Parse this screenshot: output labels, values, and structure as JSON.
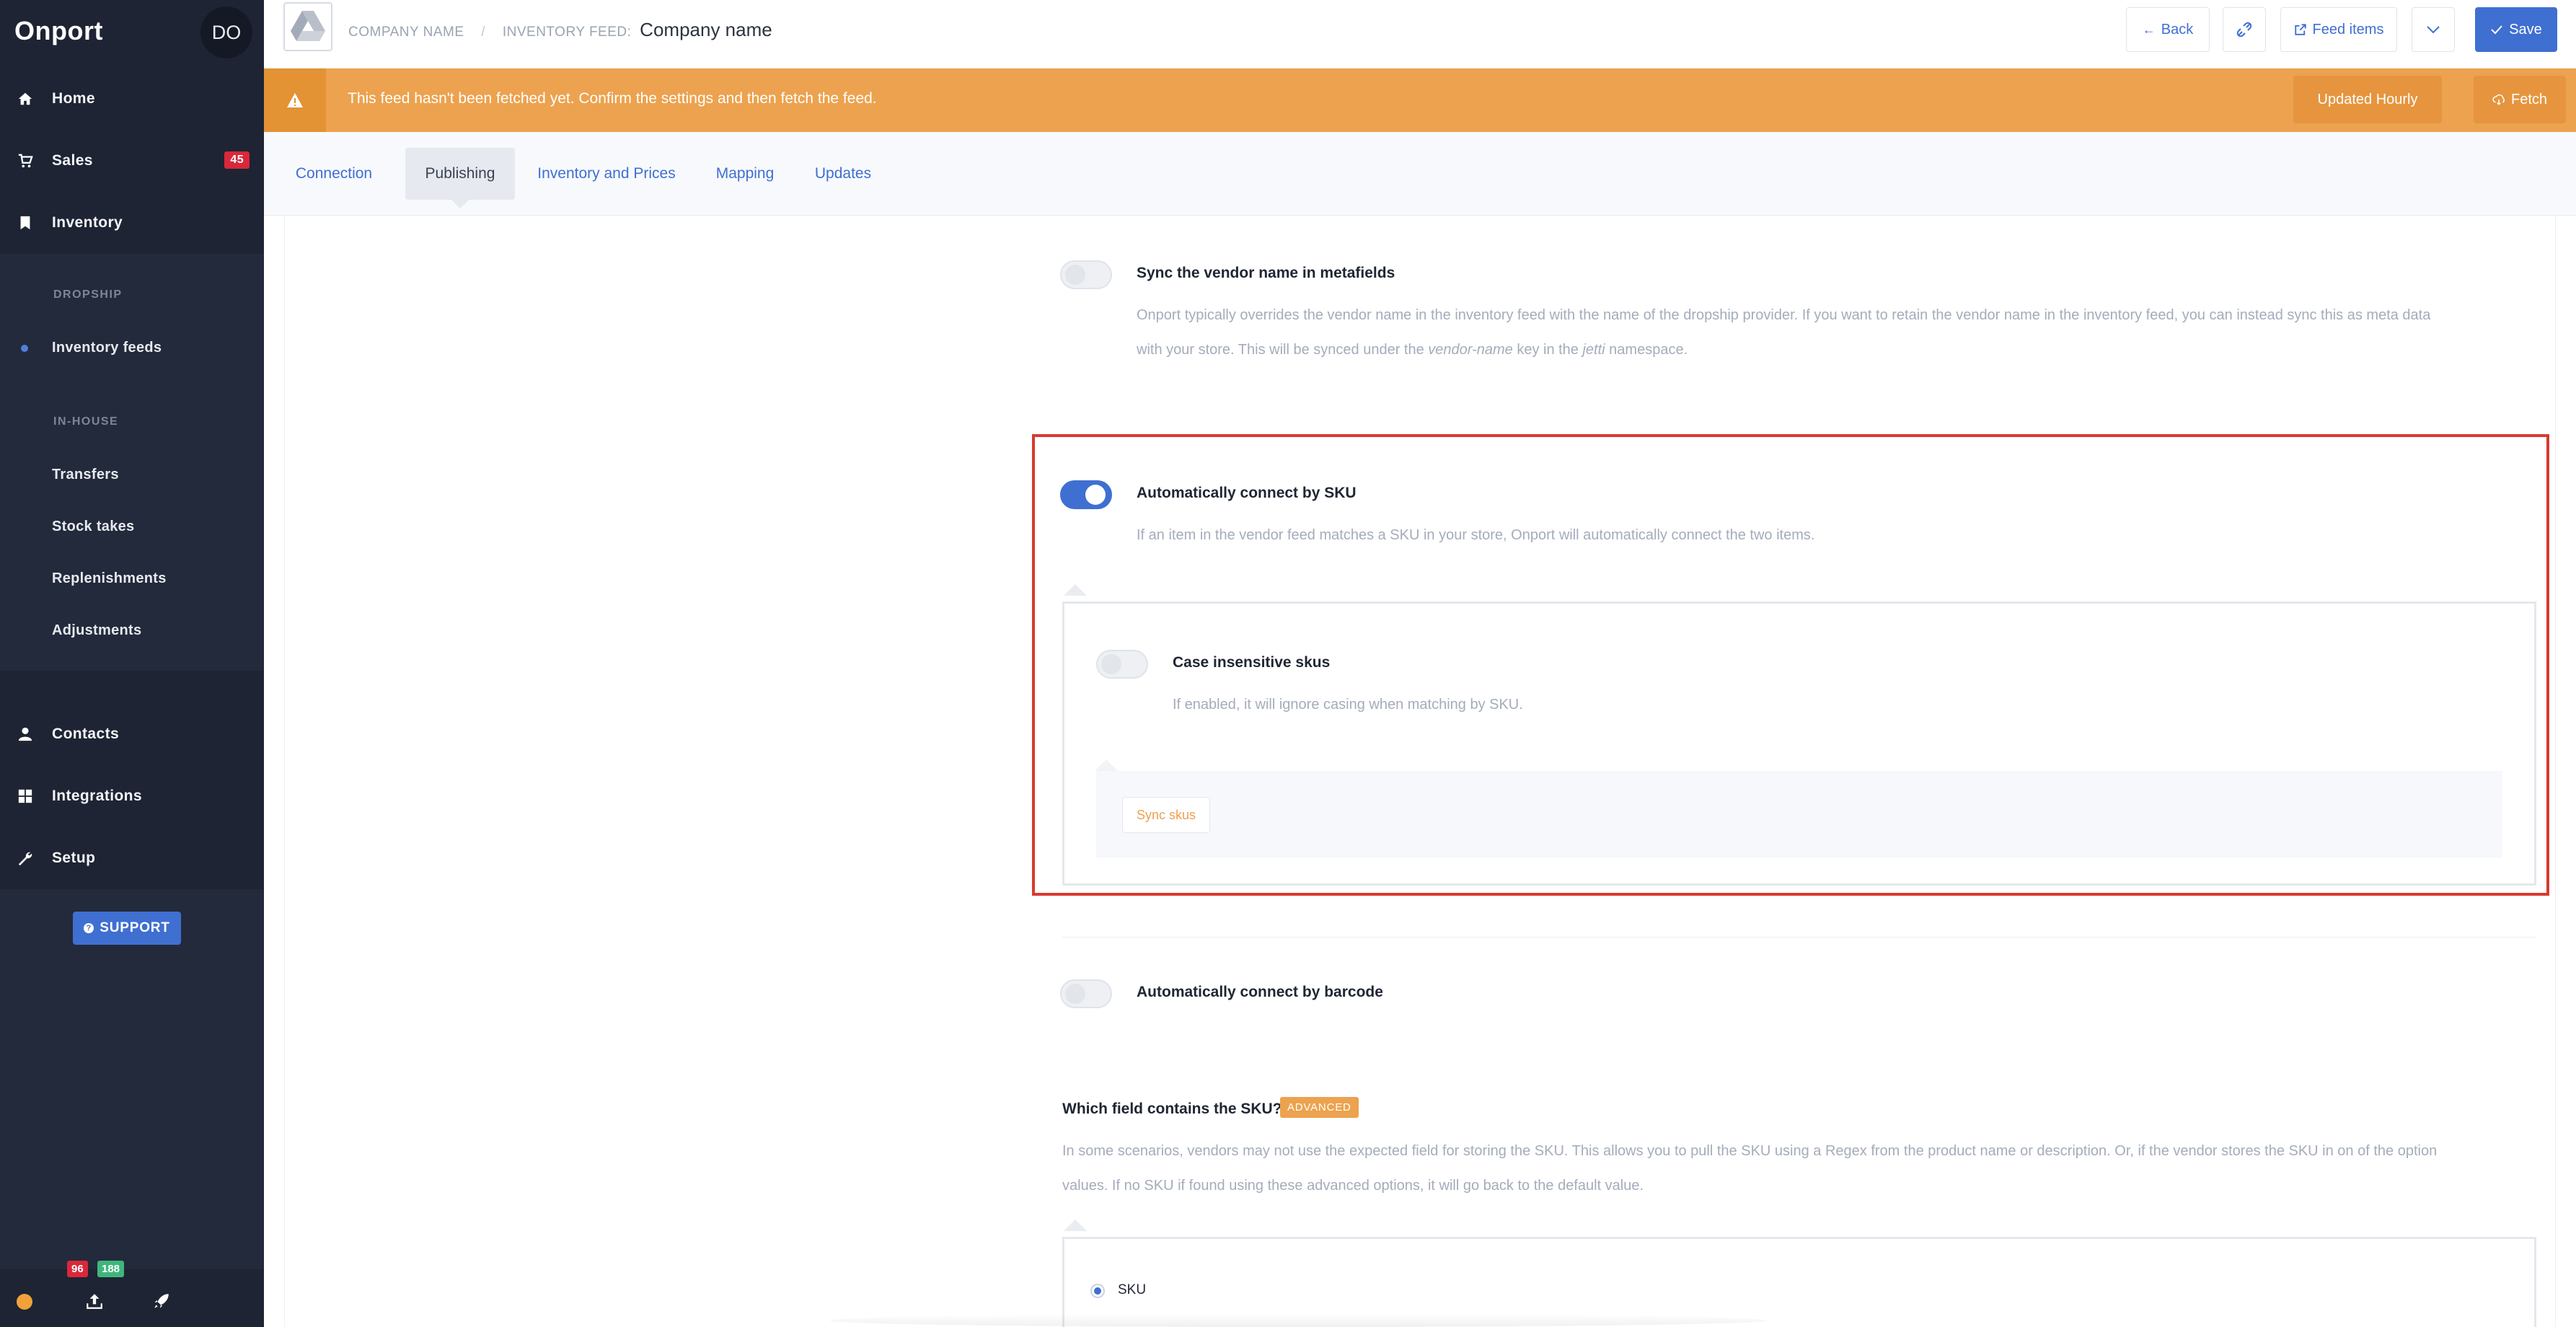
{
  "sidebar": {
    "brand": "Onport",
    "avatar_initials": "DO",
    "nav": [
      {
        "label": "Home",
        "icon": "home-icon"
      },
      {
        "label": "Sales",
        "icon": "cart-icon",
        "badge": "45"
      },
      {
        "label": "Inventory",
        "icon": "bookmark-icon"
      }
    ],
    "dropship_heading": "DROPSHIP",
    "dropship_items": [
      "Inventory feeds"
    ],
    "inhouse_heading": "IN-HOUSE",
    "inhouse_items": [
      "Transfers",
      "Stock takes",
      "Replenishments",
      "Adjustments"
    ],
    "bottom_nav": [
      {
        "label": "Contacts",
        "icon": "person-icon"
      },
      {
        "label": "Integrations",
        "icon": "grid-icon"
      },
      {
        "label": "Setup",
        "icon": "wrench-icon"
      }
    ],
    "support_label": "SUPPORT",
    "footer": {
      "badge_red": "96",
      "badge_green": "188"
    }
  },
  "topbar": {
    "company_label": "COMPANY NAME",
    "feed_label": "INVENTORY FEED:",
    "company_name": "Company name",
    "back_label": "Back",
    "feed_items_label": "Feed items",
    "save_label": "Save"
  },
  "alert": {
    "message": "This feed hasn't been fetched yet. Confirm the settings and then fetch the feed.",
    "updated_label": "Updated Hourly",
    "fetch_label": "Fetch"
  },
  "tabs": [
    "Connection",
    "Publishing",
    "Inventory and Prices",
    "Mapping",
    "Updates"
  ],
  "active_tab": "Publishing",
  "settings": {
    "vendor_sync": {
      "title": "Sync the vendor name in metafields",
      "desc_line1": "Onport typically overrides the vendor name in the inventory feed with the name of the dropship provider. If you want to retain the vendor name in the inventory feed, you can instead sync this as meta data",
      "desc_line2_a": "with your store. This will be synced under the ",
      "desc_key": "vendor-name",
      "desc_line2_b": " key in the ",
      "desc_ns": "jetti",
      "desc_line2_c": " namespace.",
      "enabled": false
    },
    "sku_connect": {
      "title": "Automatically connect by SKU",
      "desc": "If an item in the vendor feed matches a SKU in your store, Onport will automatically connect the two items.",
      "enabled": true
    },
    "case_insensitive": {
      "title": "Case insensitive skus",
      "desc": "If enabled, it will ignore casing when matching by SKU.",
      "enabled": false
    },
    "sync_skus_label": "Sync skus",
    "barcode_connect": {
      "title": "Automatically connect by barcode",
      "enabled": false
    },
    "sku_field": {
      "title": "Which field contains the SKU?",
      "badge": "ADVANCED",
      "desc_line1": "In some scenarios, vendors may not use the expected field for storing the SKU. This allows you to pull the SKU using a Regex from the product name or description. Or, if the vendor stores the SKU in on of the option",
      "desc_line2": "values. If no SKU if found using these advanced options, it will go back to the default value.",
      "option_label": "SKU"
    }
  },
  "colors": {
    "sidebar_bg": "#232a3b",
    "accent": "#3f6fd1",
    "warning": "#eca24e",
    "highlight": "#d83a2e",
    "badge_red": "#d9283a",
    "badge_green": "#3fb57c"
  }
}
